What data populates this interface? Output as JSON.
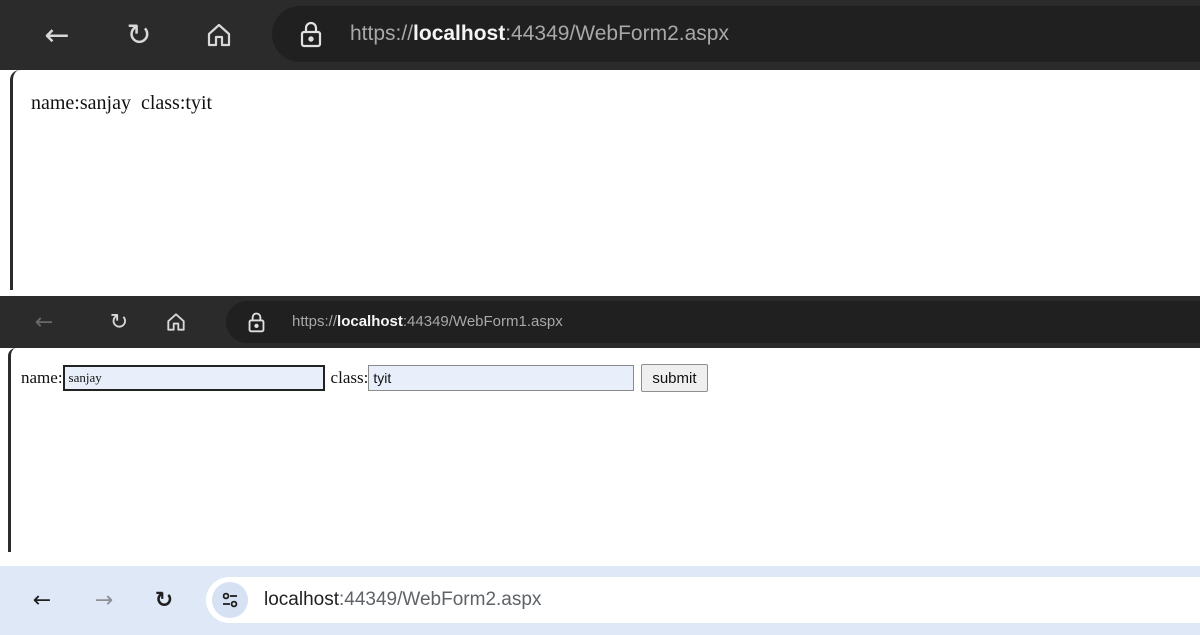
{
  "window1": {
    "url_scheme": "https://",
    "url_host": "localhost",
    "url_rest": ":44349/WebForm2.aspx",
    "output_text": "name:sanjay  class:tyit",
    "icons": {
      "back": "arrow-left-icon",
      "reload": "reload-icon",
      "home": "home-icon",
      "lock": "lock-icon"
    }
  },
  "window2": {
    "url_scheme": "https://",
    "url_host": "localhost",
    "url_rest": ":44349/WebForm1.aspx",
    "form": {
      "name_label": "name:",
      "name_value": "sanjay",
      "class_label": "class:",
      "class_value": "tyit",
      "submit_label": "submit"
    },
    "icons": {
      "back": "arrow-left-icon",
      "reload": "reload-icon",
      "home": "home-icon",
      "lock": "lock-icon"
    }
  },
  "window3": {
    "url_host": "localhost",
    "url_rest": ":44349/WebForm2.aspx",
    "icons": {
      "back": "arrow-left-icon",
      "forward": "arrow-right-icon",
      "reload": "reload-icon",
      "site_info": "tune-icon"
    }
  },
  "colors": {
    "dark_toolbar": "#2b2b2b",
    "dark_address": "#202020",
    "light_toolbar": "#dfe8f6",
    "input_fill": "#e8effb"
  }
}
